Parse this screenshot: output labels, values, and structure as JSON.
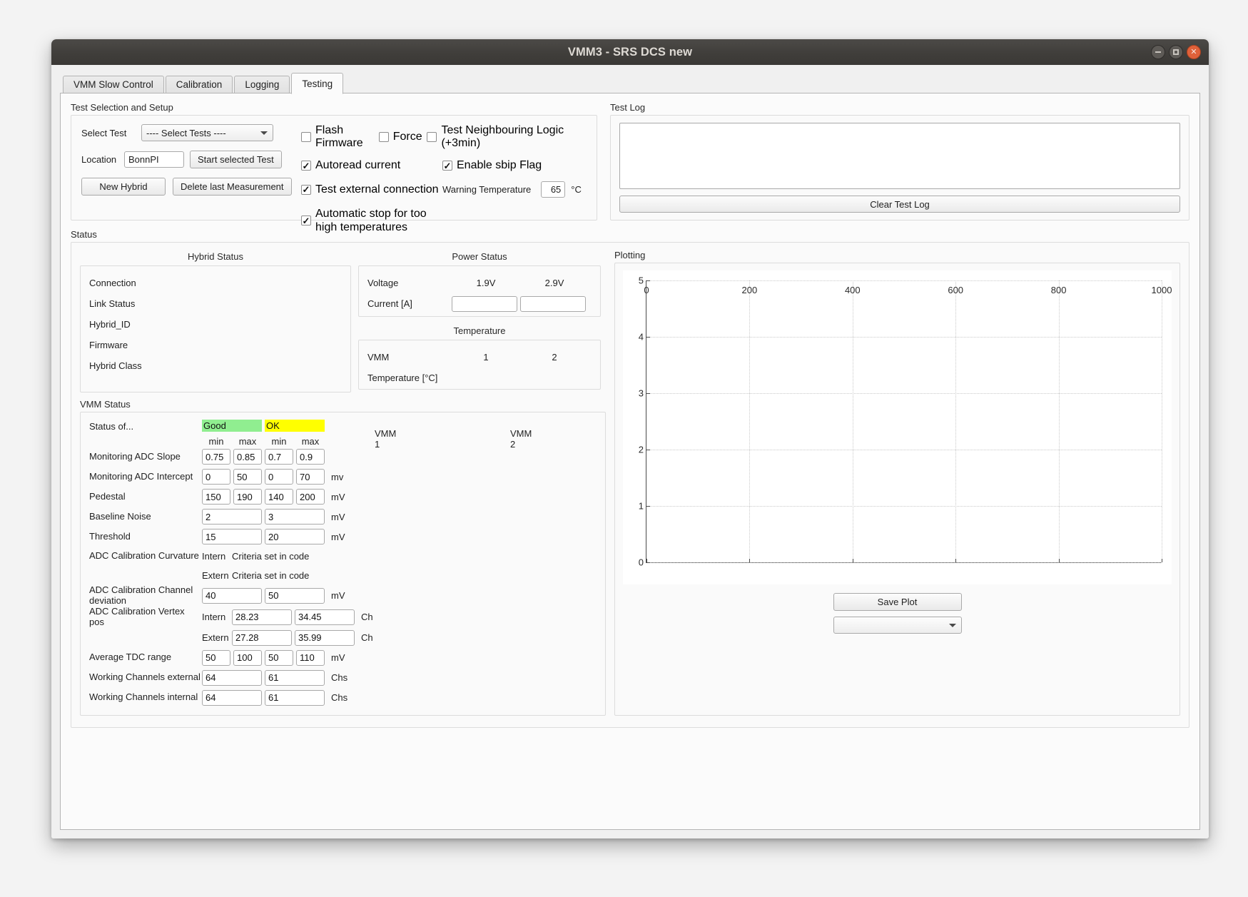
{
  "window": {
    "title": "VMM3 - SRS DCS new",
    "controls": {
      "minimize": "–",
      "maximize": "□",
      "close": "✕"
    }
  },
  "tabs": [
    {
      "label": "VMM Slow Control",
      "active": false
    },
    {
      "label": "Calibration",
      "active": false
    },
    {
      "label": "Logging",
      "active": false
    },
    {
      "label": "Testing",
      "active": true
    }
  ],
  "test_setup": {
    "title": "Test Selection and Setup",
    "select_test_label": "Select Test",
    "select_test_value": "---- Select Tests ----",
    "location_label": "Location",
    "location_value": "BonnPI",
    "start_button": "Start selected Test",
    "new_hybrid_button": "New Hybrid",
    "delete_button": "Delete last Measurement",
    "checkboxes": [
      {
        "label": "Flash Firmware",
        "checked": false
      },
      {
        "label": "Force",
        "checked": false
      },
      {
        "label": "Test Neighbouring Logic (+3min)",
        "checked": false
      },
      {
        "label": "Autoread current",
        "checked": true
      },
      {
        "label": "Enable sbip Flag",
        "checked": true
      },
      {
        "label": "Test external connection",
        "checked": true
      },
      {
        "label": "Automatic stop for too high temperatures",
        "checked": true
      }
    ],
    "warning_temp_label": "Warning Temperature",
    "warning_temp_value": "65",
    "warning_temp_unit": "°C"
  },
  "test_log": {
    "title": "Test Log",
    "content": "",
    "clear_button": "Clear Test Log"
  },
  "status": {
    "title": "Status",
    "hybrid": {
      "title": "Hybrid Status",
      "rows": [
        "Connection",
        "Link Status",
        "Hybrid_ID",
        "Firmware",
        "Hybrid Class"
      ]
    },
    "power": {
      "title": "Power Status",
      "voltage_label": "Voltage",
      "voltage_1": "1.9V",
      "voltage_2": "2.9V",
      "current_label": "Current [A]",
      "current_1": "",
      "current_2": ""
    },
    "temperature": {
      "title": "Temperature",
      "vmm_label": "VMM",
      "vmm_1": "1",
      "vmm_2": "2",
      "temp_label": "Temperature [°C]",
      "temp_1": "",
      "temp_2": ""
    }
  },
  "vmm_status": {
    "title": "VMM Status",
    "status_of_label": "Status of...",
    "good_label": "Good",
    "ok_label": "OK",
    "good_color": "#90EE90",
    "ok_color": "#FFFF00",
    "min_label": "min",
    "max_label": "max",
    "vmm1_header": "VMM 1",
    "vmm2_header": "VMM 2",
    "rows": [
      {
        "label": "Monitoring ADC Slope",
        "sub": "",
        "style": "narrow4",
        "good_min": "0.75",
        "good_max": "0.85",
        "ok_min": "0.7",
        "ok_max": "0.9",
        "unit": ""
      },
      {
        "label": "Monitoring ADC Intercept",
        "sub": "",
        "style": "narrow4",
        "good_min": "0",
        "good_max": "50",
        "ok_min": "0",
        "ok_max": "70",
        "unit": "mv"
      },
      {
        "label": "Pedestal",
        "sub": "",
        "style": "narrow4",
        "good_min": "150",
        "good_max": "190",
        "ok_min": "140",
        "ok_max": "200",
        "unit": "mV"
      },
      {
        "label": "Baseline Noise",
        "sub": "",
        "style": "wide2",
        "good_min": "2",
        "good_max": "3",
        "unit": "mV"
      },
      {
        "label": "Threshold",
        "sub": "",
        "style": "wide2",
        "good_min": "15",
        "good_max": "20",
        "unit": "mV"
      },
      {
        "label": "ADC Calibration Curvature",
        "sub": "Intern",
        "style": "static",
        "text": "Criteria set in code"
      },
      {
        "label": "",
        "sub": "Extern",
        "style": "static",
        "text": "Criteria set in code"
      },
      {
        "label": "ADC Calibration Channel deviation",
        "sub": "",
        "style": "wide2",
        "good_min": "40",
        "good_max": "50",
        "unit": "mV"
      },
      {
        "label": "ADC Calibration Vertex pos",
        "sub": "Intern",
        "style": "wide2",
        "good_min": "28.23",
        "good_max": "34.45",
        "unit": "Ch"
      },
      {
        "label": "",
        "sub": "Extern",
        "style": "wide2",
        "good_min": "27.28",
        "good_max": "35.99",
        "unit": "Ch"
      },
      {
        "label": "Average TDC range",
        "sub": "",
        "style": "narrow4",
        "good_min": "50",
        "good_max": "100",
        "ok_min": "50",
        "ok_max": "110",
        "unit": "mV"
      },
      {
        "label": "Working Channels external",
        "sub": "",
        "style": "wide2",
        "good_min": "64",
        "good_max": "61",
        "unit": "Chs"
      },
      {
        "label": "Working Channels internal",
        "sub": "",
        "style": "wide2",
        "good_min": "64",
        "good_max": "61",
        "unit": "Chs"
      }
    ]
  },
  "plotting": {
    "title": "Plotting",
    "save_button": "Save Plot",
    "select_value": ""
  },
  "chart_data": {
    "type": "line",
    "title": "",
    "xlabel": "",
    "ylabel": "",
    "xlim": [
      0,
      1000
    ],
    "ylim": [
      0,
      5
    ],
    "xticks": [
      0,
      200,
      400,
      600,
      800,
      1000
    ],
    "yticks": [
      0,
      1,
      2,
      3,
      4,
      5
    ],
    "grid": true,
    "series": [],
    "legend": null
  }
}
